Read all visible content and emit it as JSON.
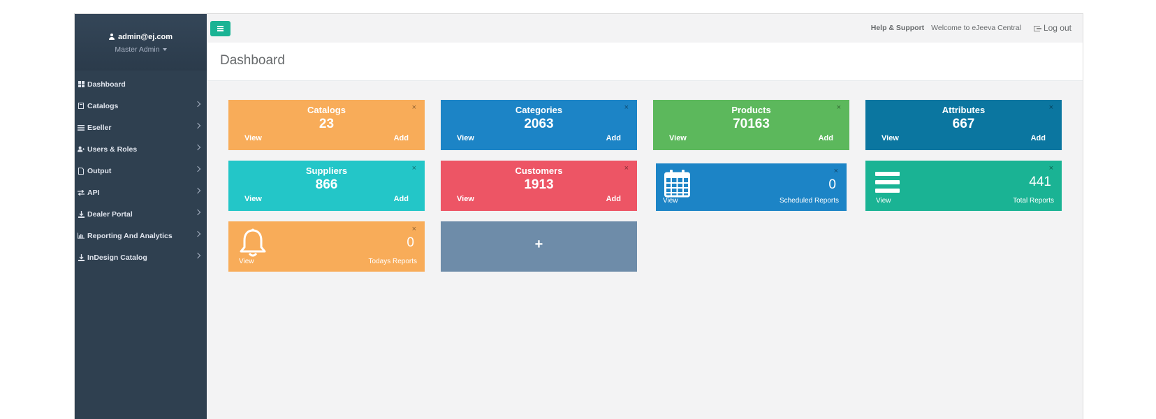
{
  "user": {
    "email": "admin@ej.com",
    "role": "Master Admin"
  },
  "nav": [
    {
      "label": "Dashboard",
      "icon": "dashboard-icon",
      "chevron": false
    },
    {
      "label": "Catalogs",
      "icon": "book-icon",
      "chevron": true
    },
    {
      "label": "Eseller",
      "icon": "list-icon",
      "chevron": true
    },
    {
      "label": "Users & Roles",
      "icon": "users-icon",
      "chevron": true
    },
    {
      "label": "Output",
      "icon": "file-pdf-icon",
      "chevron": true
    },
    {
      "label": "API",
      "icon": "exchange-icon",
      "chevron": true
    },
    {
      "label": "Dealer Portal",
      "icon": "download-icon",
      "chevron": true
    },
    {
      "label": "Reporting And Analytics",
      "icon": "bar-chart-icon",
      "chevron": true
    },
    {
      "label": "InDesign Catalog",
      "icon": "download-icon",
      "chevron": true
    }
  ],
  "topbar": {
    "help": "Help & Support",
    "welcome": "Welcome to eJeeva Central",
    "logout": "Log out"
  },
  "page": {
    "title": "Dashboard"
  },
  "widgets": {
    "catalogs": {
      "title": "Catalogs",
      "count": "23",
      "view": "View",
      "add": "Add",
      "color": "#f8ac59"
    },
    "categories": {
      "title": "Categories",
      "count": "2063",
      "view": "View",
      "add": "Add",
      "color": "#1c84c6"
    },
    "products": {
      "title": "Products",
      "count": "70163",
      "view": "View",
      "add": "Add",
      "color": "#5cb85c"
    },
    "attributes": {
      "title": "Attributes",
      "count": "667",
      "view": "View",
      "add": "Add",
      "color": "#0b76a0"
    },
    "suppliers": {
      "title": "Suppliers",
      "count": "866",
      "view": "View",
      "add": "Add",
      "color": "#23c6c8"
    },
    "customers": {
      "title": "Customers",
      "count": "1913",
      "view": "View",
      "add": "Add",
      "color": "#ed5565"
    },
    "scheduled": {
      "count": "0",
      "view": "View",
      "label": "Scheduled Reports",
      "icon": "calendar-icon",
      "color": "#1c84c6"
    },
    "total": {
      "count": "441",
      "view": "View",
      "label": "Total Reports",
      "icon": "list-icon",
      "color": "#1ab394"
    },
    "todays": {
      "count": "0",
      "view": "View",
      "label": "Todays Reports",
      "icon": "bell-icon",
      "color": "#f8ac59"
    },
    "add_tile": {
      "symbol": "+",
      "color": "#6e8ca9"
    }
  },
  "close_symbol": "×"
}
